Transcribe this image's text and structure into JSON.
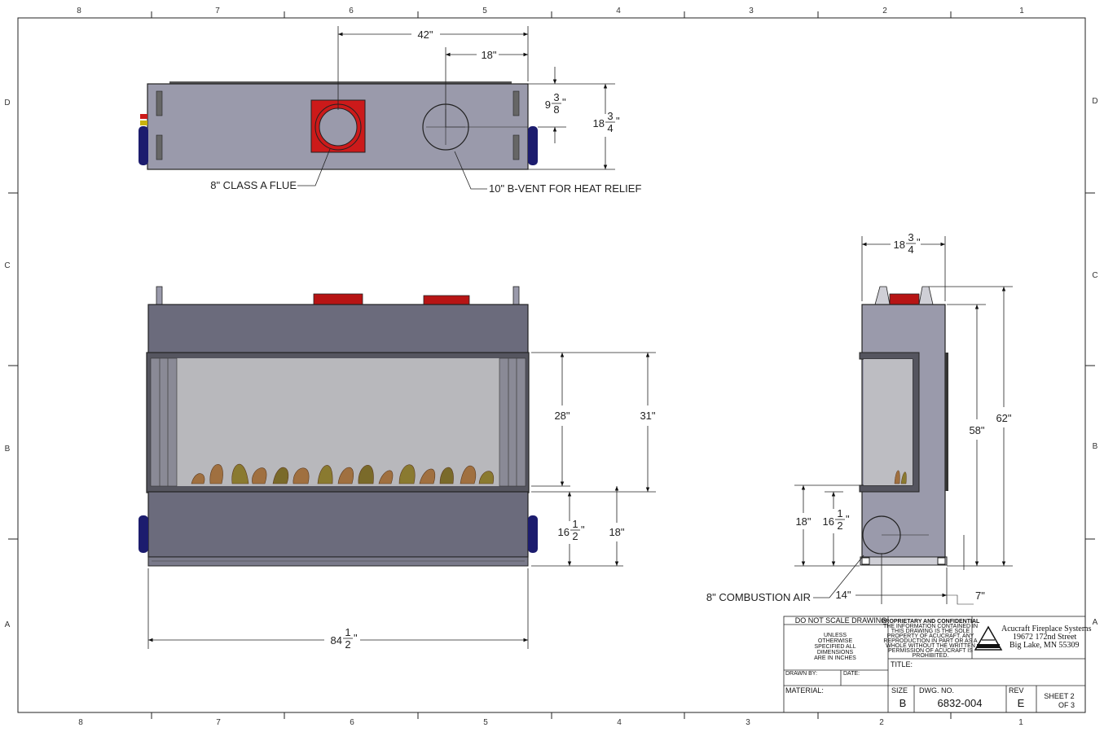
{
  "zones": {
    "top": [
      "8",
      "7",
      "6",
      "5",
      "4",
      "3",
      "2",
      "1"
    ],
    "bottom": [
      "8",
      "7",
      "6",
      "5",
      "4",
      "3",
      "2",
      "1"
    ],
    "left": [
      "D",
      "C",
      "B",
      "A"
    ],
    "right": [
      "D",
      "C",
      "B",
      "A"
    ]
  },
  "top_view": {
    "dim_overall_offset": "42\"",
    "dim_vent_offset": "18\"",
    "dim_flue_depth": {
      "whole": "9",
      "num": "3",
      "den": "8",
      "unit": "\""
    },
    "dim_depth": {
      "whole": "18",
      "num": "3",
      "den": "4",
      "unit": "\""
    },
    "note_flue": "8\" CLASS A FLUE",
    "note_vent": "10\" B-VENT FOR HEAT RELIEF",
    "colors": {
      "body": "#9a9aab",
      "flue": "#cc1a1a",
      "outline": "#222222"
    }
  },
  "front_view": {
    "dim_glass_height": "28\"",
    "dim_opening_height": "31\"",
    "dim_base_low": {
      "whole": "16",
      "num": "1",
      "den": "2",
      "unit": "\""
    },
    "dim_base_high": "18\"",
    "dim_width": {
      "whole": "84",
      "num": "1",
      "den": "2",
      "unit": "\""
    },
    "colors": {
      "body": "#6b6b7c",
      "glass": "#b8b8bc",
      "blue": "#1c1c6e",
      "flame": "#a07040"
    }
  },
  "side_view": {
    "dim_depth": {
      "whole": "18",
      "num": "3",
      "den": "4",
      "unit": "\""
    },
    "dim_total_height": "62\"",
    "dim_body_height": "58\"",
    "dim_base_high": "18\"",
    "dim_base_low": {
      "whole": "16",
      "num": "1",
      "den": "2",
      "unit": "\""
    },
    "dim_air_offset": "14\"",
    "dim_air_inset": "7\"",
    "note_air": "8\" COMBUSTION AIR"
  },
  "title_block": {
    "no_scale": "DO NOT SCALE DRAWING",
    "units_lines": [
      "UNLESS",
      "OTHERWISE",
      "SPECIFIED ALL",
      "DIMENSIONS",
      "ARE IN INCHES"
    ],
    "drawn_by": "DRAWN BY:",
    "date": "DATE:",
    "material": "MATERIAL:",
    "proprietary_lines": [
      "PROPRIETARY AND CONFIDENTIAL",
      "THE INFORMATION CONTAINED IN",
      "THIS DRAWING IS THE SOLE",
      "PROPERTY OF ACUCRAFT. ANY",
      "REPRODUCTION IN PART OR AS A",
      "WHOLE WITHOUT THE WRITTEN",
      "PERMISSION OF ACUCRAFT IS",
      "PROHIBITED."
    ],
    "company_lines": [
      "Acucraft Fireplace Systems",
      "19672 172nd Street",
      "Big Lake, MN 55309"
    ],
    "title_label": "TITLE:",
    "size_label": "SIZE",
    "size_value": "B",
    "dwg_label": "DWG.  NO.",
    "dwg_value": "6832-004",
    "rev_label": "REV",
    "rev_value": "E",
    "sheet_line1": "SHEET 2",
    "sheet_line2": "OF 3"
  }
}
